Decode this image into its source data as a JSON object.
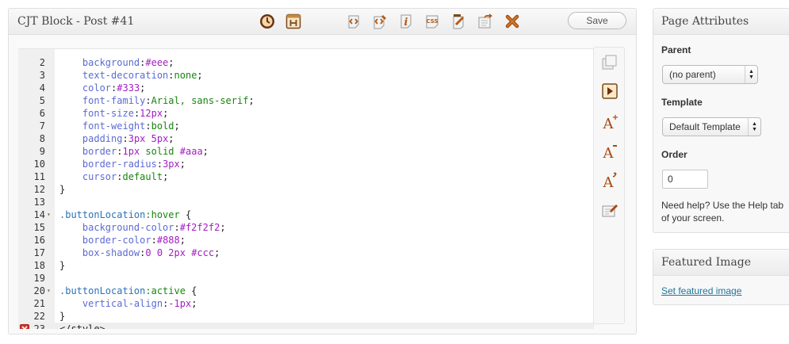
{
  "cjt_block": {
    "title": "CJT Block - Post #41",
    "save_label": "Save",
    "toolbar_icons": [
      "revision-clock-icon",
      "html-block-icon",
      "code-tag-icon",
      "code-edit-icon",
      "info-icon",
      "css-icon",
      "template-icon",
      "export-icon",
      "delete-icon"
    ]
  },
  "editor": {
    "lines": [
      {
        "num": "2",
        "fold": false,
        "parts": [
          {
            "t": "    ",
            "c": "text"
          },
          {
            "t": "background",
            "c": "prop"
          },
          {
            "t": ":",
            "c": "text"
          },
          {
            "t": "#eee",
            "c": "num"
          },
          {
            "t": ";",
            "c": "text"
          }
        ]
      },
      {
        "num": "3",
        "fold": false,
        "parts": [
          {
            "t": "    ",
            "c": "text"
          },
          {
            "t": "text-decoration",
            "c": "prop"
          },
          {
            "t": ":",
            "c": "text"
          },
          {
            "t": "none",
            "c": "val"
          },
          {
            "t": ";",
            "c": "text"
          }
        ]
      },
      {
        "num": "4",
        "fold": false,
        "parts": [
          {
            "t": "    ",
            "c": "text"
          },
          {
            "t": "color",
            "c": "prop"
          },
          {
            "t": ":",
            "c": "text"
          },
          {
            "t": "#333",
            "c": "num"
          },
          {
            "t": ";",
            "c": "text"
          }
        ]
      },
      {
        "num": "5",
        "fold": false,
        "parts": [
          {
            "t": "    ",
            "c": "text"
          },
          {
            "t": "font-family",
            "c": "prop"
          },
          {
            "t": ":",
            "c": "text"
          },
          {
            "t": "Arial, sans-serif",
            "c": "val"
          },
          {
            "t": ";",
            "c": "text"
          }
        ]
      },
      {
        "num": "6",
        "fold": false,
        "parts": [
          {
            "t": "    ",
            "c": "text"
          },
          {
            "t": "font-size",
            "c": "prop"
          },
          {
            "t": ":",
            "c": "text"
          },
          {
            "t": "12px",
            "c": "num"
          },
          {
            "t": ";",
            "c": "text"
          }
        ]
      },
      {
        "num": "7",
        "fold": false,
        "parts": [
          {
            "t": "    ",
            "c": "text"
          },
          {
            "t": "font-weight",
            "c": "prop"
          },
          {
            "t": ":",
            "c": "text"
          },
          {
            "t": "bold",
            "c": "val"
          },
          {
            "t": ";",
            "c": "text"
          }
        ]
      },
      {
        "num": "8",
        "fold": false,
        "parts": [
          {
            "t": "    ",
            "c": "text"
          },
          {
            "t": "padding",
            "c": "prop"
          },
          {
            "t": ":",
            "c": "text"
          },
          {
            "t": "3px 5px",
            "c": "num"
          },
          {
            "t": ";",
            "c": "text"
          }
        ]
      },
      {
        "num": "9",
        "fold": false,
        "parts": [
          {
            "t": "    ",
            "c": "text"
          },
          {
            "t": "border",
            "c": "prop"
          },
          {
            "t": ":",
            "c": "text"
          },
          {
            "t": "1px",
            "c": "num"
          },
          {
            "t": " solid ",
            "c": "val"
          },
          {
            "t": "#aaa",
            "c": "num"
          },
          {
            "t": ";",
            "c": "text"
          }
        ]
      },
      {
        "num": "10",
        "fold": false,
        "parts": [
          {
            "t": "    ",
            "c": "text"
          },
          {
            "t": "border-radius",
            "c": "prop"
          },
          {
            "t": ":",
            "c": "text"
          },
          {
            "t": "3px",
            "c": "num"
          },
          {
            "t": ";",
            "c": "text"
          }
        ]
      },
      {
        "num": "11",
        "fold": false,
        "parts": [
          {
            "t": "    ",
            "c": "text"
          },
          {
            "t": "cursor",
            "c": "prop"
          },
          {
            "t": ":",
            "c": "text"
          },
          {
            "t": "default",
            "c": "val"
          },
          {
            "t": ";",
            "c": "text"
          }
        ]
      },
      {
        "num": "12",
        "fold": false,
        "parts": [
          {
            "t": "}",
            "c": "text"
          }
        ]
      },
      {
        "num": "13",
        "fold": false,
        "parts": []
      },
      {
        "num": "14",
        "fold": true,
        "parts": [
          {
            "t": ".buttonLocation",
            "c": "sel"
          },
          {
            "t": ":hover",
            "c": "val"
          },
          {
            "t": " {",
            "c": "text"
          }
        ]
      },
      {
        "num": "15",
        "fold": false,
        "parts": [
          {
            "t": "    ",
            "c": "text"
          },
          {
            "t": "background-color",
            "c": "prop"
          },
          {
            "t": ":",
            "c": "text"
          },
          {
            "t": "#f2f2f2",
            "c": "num"
          },
          {
            "t": ";",
            "c": "text"
          }
        ]
      },
      {
        "num": "16",
        "fold": false,
        "parts": [
          {
            "t": "    ",
            "c": "text"
          },
          {
            "t": "border-color",
            "c": "prop"
          },
          {
            "t": ":",
            "c": "text"
          },
          {
            "t": "#888",
            "c": "num"
          },
          {
            "t": ";",
            "c": "text"
          }
        ]
      },
      {
        "num": "17",
        "fold": false,
        "parts": [
          {
            "t": "    ",
            "c": "text"
          },
          {
            "t": "box-shadow",
            "c": "prop"
          },
          {
            "t": ":",
            "c": "text"
          },
          {
            "t": "0 0 2px #ccc",
            "c": "num"
          },
          {
            "t": ";",
            "c": "text"
          }
        ]
      },
      {
        "num": "18",
        "fold": false,
        "parts": [
          {
            "t": "}",
            "c": "text"
          }
        ]
      },
      {
        "num": "19",
        "fold": false,
        "parts": []
      },
      {
        "num": "20",
        "fold": true,
        "parts": [
          {
            "t": ".buttonLocation",
            "c": "sel"
          },
          {
            "t": ":active",
            "c": "val"
          },
          {
            "t": " {",
            "c": "text"
          }
        ]
      },
      {
        "num": "21",
        "fold": false,
        "parts": [
          {
            "t": "    ",
            "c": "text"
          },
          {
            "t": "vertical-align",
            "c": "prop"
          },
          {
            "t": ":",
            "c": "text"
          },
          {
            "t": "-1px",
            "c": "num"
          },
          {
            "t": ";",
            "c": "text"
          }
        ]
      },
      {
        "num": "22",
        "fold": false,
        "parts": [
          {
            "t": "}",
            "c": "text"
          }
        ]
      },
      {
        "num": "23",
        "fold": false,
        "error": true,
        "current": true,
        "parts": [
          {
            "t": "</style>",
            "c": "text"
          }
        ]
      }
    ]
  },
  "tools": [
    "layers-icon",
    "run-icon",
    "font-increase-icon",
    "font-decrease-icon",
    "font-reset-icon",
    "note-edit-icon"
  ],
  "page_attributes": {
    "title": "Page Attributes",
    "parent_label": "Parent",
    "parent_value": "(no parent)",
    "template_label": "Template",
    "template_value": "Default Template",
    "order_label": "Order",
    "order_value": "0",
    "help_line1": "Need help? Use the Help tab",
    "help_line2": "of your screen."
  },
  "featured_image": {
    "title": "Featured Image",
    "link": "Set featured image"
  },
  "colors": {
    "prop": "#5c6bd3",
    "value": "#18840f",
    "number": "#a11dc2",
    "selector": "#2a73b8",
    "link": "#21759b",
    "icon_brown": "#b35a16"
  }
}
